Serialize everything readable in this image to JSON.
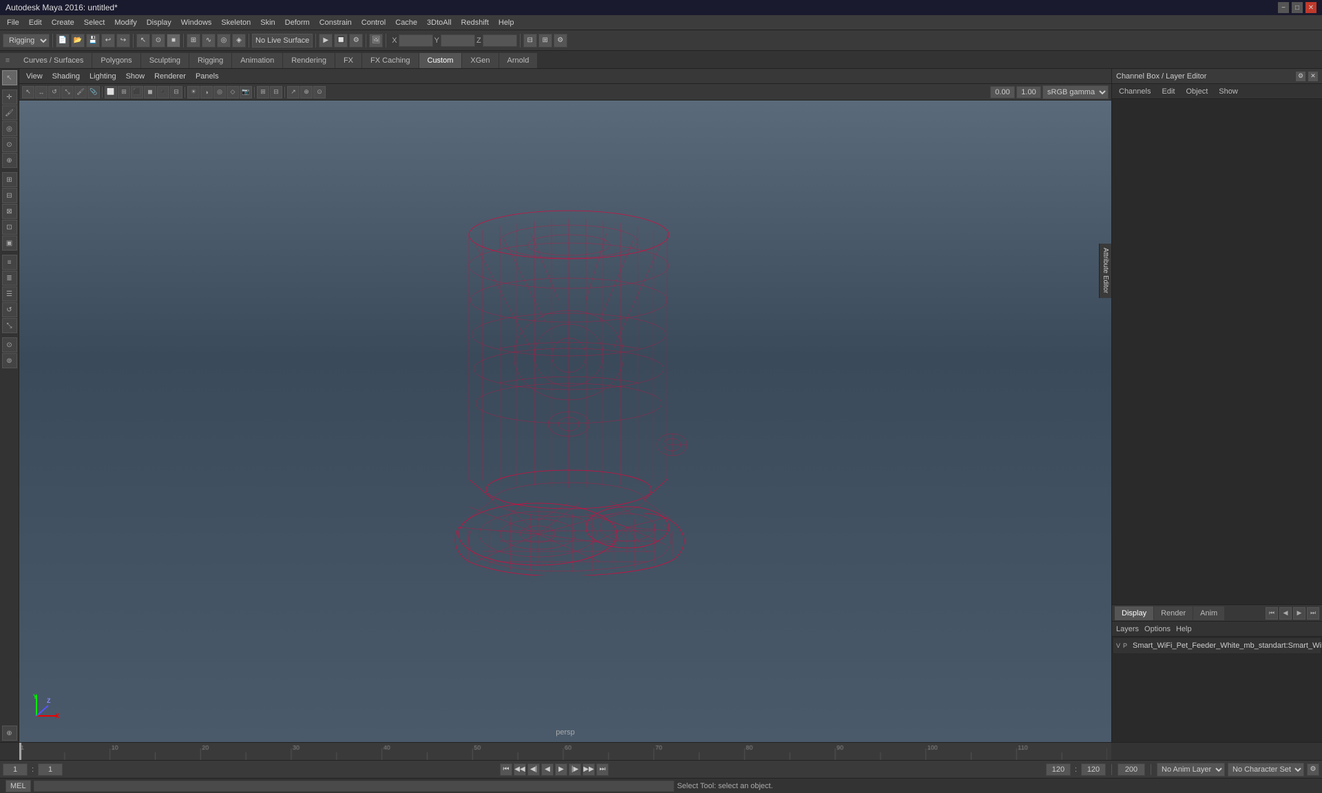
{
  "titleBar": {
    "title": "Autodesk Maya 2016: untitled*",
    "minimizeBtn": "−",
    "maximizeBtn": "□",
    "closeBtn": "✕"
  },
  "menuBar": {
    "items": [
      "File",
      "Edit",
      "Create",
      "Select",
      "Modify",
      "Display",
      "Windows",
      "Skeleton",
      "Skin",
      "Deform",
      "Constrain",
      "Control",
      "Cache",
      "3DtoAll",
      "Redshift",
      "Help"
    ]
  },
  "toolbar1": {
    "mode": "Rigging",
    "noLiveSurface": "No Live Surface",
    "xLabel": "X",
    "yLabel": "Y",
    "zLabel": "Z"
  },
  "tabBar": {
    "tabs": [
      "Curves / Surfaces",
      "Polygons",
      "Sculpting",
      "Rigging",
      "Animation",
      "Rendering",
      "FX",
      "FX Caching",
      "Custom",
      "XGen",
      "Arnold"
    ],
    "activeTab": "Custom"
  },
  "viewportMenu": {
    "items": [
      "View",
      "Shading",
      "Lighting",
      "Show",
      "Renderer",
      "Panels"
    ]
  },
  "viewportLabel": "persp",
  "channelBox": {
    "title": "Channel Box / Layer Editor",
    "tabs": [
      "Channels",
      "Edit",
      "Object",
      "Show"
    ]
  },
  "displayTabs": {
    "tabs": [
      "Display",
      "Render",
      "Anim"
    ],
    "activeTab": "Display",
    "options": [
      "Layers",
      "Options",
      "Help"
    ]
  },
  "layerRow": {
    "v": "V",
    "p": "P",
    "name": "Smart_WiFi_Pet_Feeder_White_mb_standart:Smart_WiFi_"
  },
  "playback": {
    "currentFrame": "1",
    "startFrame": "1",
    "endFrame": "120",
    "rangeEnd": "120",
    "totalFrames": "200",
    "noAnimLayer": "No Anim Layer",
    "noCharSet": "No Character Set"
  },
  "statusBar": {
    "mel": "MEL",
    "status": "Select Tool: select an object."
  },
  "viewport": {
    "gamma1": "0.00",
    "gamma2": "1.00",
    "gammaMode": "sRGB gamma"
  },
  "icons": {
    "leftTools": [
      "arrow-select",
      "move",
      "paint",
      "polygon",
      "sculpt-tools",
      "grab",
      "separator1",
      "shape-group",
      "layers-a",
      "layers-b",
      "layers-c",
      "move-b",
      "rotate-b",
      "scale-b",
      "separator2",
      "snap-a",
      "snap-b"
    ],
    "playback": [
      "rewind-to-start",
      "step-back",
      "prev-key",
      "play-back",
      "play",
      "next-key",
      "step-forward",
      "forward-to-end"
    ]
  }
}
